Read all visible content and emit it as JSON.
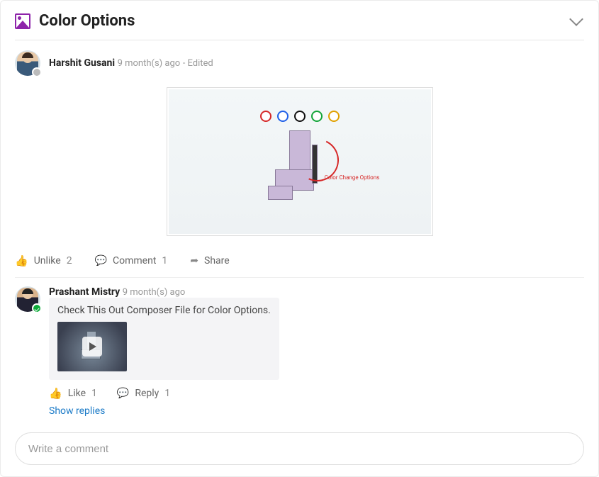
{
  "header": {
    "title": "Color Options"
  },
  "post": {
    "author": "Harshit Gusani",
    "timestamp": "9 month(s) ago",
    "edited_label": "- Edited",
    "annotation_text": "Color Change Options"
  },
  "actions": {
    "unlike_label": "Unlike",
    "like_count": "2",
    "comment_label": "Comment",
    "comment_count": "1",
    "share_label": "Share"
  },
  "comment": {
    "author": "Prashant Mistry",
    "timestamp": "9 month(s) ago",
    "text": "Check This Out Composer File for Color Options.",
    "actions": {
      "like_label": "Like",
      "like_count": "1",
      "reply_label": "Reply",
      "reply_count": "1"
    },
    "show_replies": "Show replies"
  },
  "compose": {
    "placeholder": "Write a comment"
  }
}
